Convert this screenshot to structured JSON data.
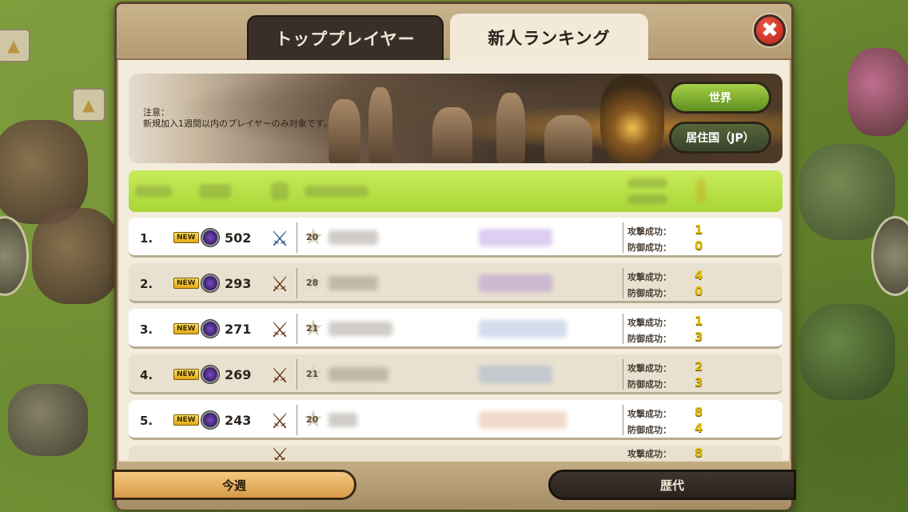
{
  "tabs": {
    "top_players": "トッププレイヤー",
    "newcomer_ranking": "新人ランキング"
  },
  "close_icon": "✖",
  "banner": {
    "notice_title": "注意：",
    "notice_text": "新規加入1週間以内のプレイヤーのみ対象です。",
    "world_button": "世界",
    "country_button": "居住国（JP）"
  },
  "badge": "NEW",
  "stat_labels": {
    "attack": "攻撃成功：",
    "defense": "防御成功："
  },
  "rows": [
    {
      "rank": "1.",
      "trophies": "502",
      "level": "20",
      "attack": "1",
      "defense": "0",
      "clan_color": "#8a5ad0"
    },
    {
      "rank": "2.",
      "trophies": "293",
      "level": "28",
      "attack": "4",
      "defense": "0",
      "clan_color": "#8a5ad0"
    },
    {
      "rank": "3.",
      "trophies": "271",
      "level": "21",
      "attack": "1",
      "defense": "3",
      "clan_color": "#7a9ac8"
    },
    {
      "rank": "4.",
      "trophies": "269",
      "level": "21",
      "attack": "2",
      "defense": "3",
      "clan_color": "#7a9ac8"
    },
    {
      "rank": "5.",
      "trophies": "243",
      "level": "20",
      "attack": "8",
      "defense": "4",
      "clan_color": "#d8946a"
    }
  ],
  "partial_row": {
    "attack_label": "攻撃成功：",
    "attack": "8"
  },
  "footer": {
    "this_week": "今週",
    "all_time": "歴代"
  }
}
